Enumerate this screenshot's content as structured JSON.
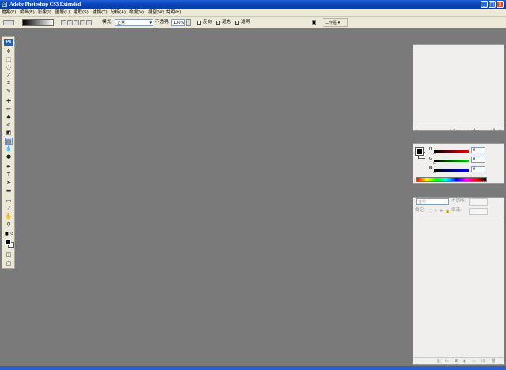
{
  "window": {
    "title": "Adobe Photoshop CS3 Extended"
  },
  "menu": [
    "檔案(F)",
    "編輯(E)",
    "影像(I)",
    "圖層(L)",
    "選取(S)",
    "濾鏡(T)",
    "分析(A)",
    "檢視(V)",
    "視窗(W)",
    "說明(H)"
  ],
  "options": {
    "mode_label": "模式:",
    "mode_value": "正常",
    "opacity_label": "不透明:",
    "opacity_value": "100%",
    "reverse_label": "反向",
    "dither_label": "遞色",
    "transparency_label": "透明",
    "workspace_label": "工作區 ▾"
  },
  "toolbox": {
    "badge": "Ps"
  },
  "color_panel": {
    "channels": [
      {
        "label": "R",
        "value": "0",
        "color": "#cc0000"
      },
      {
        "label": "G",
        "value": "0",
        "color": "#00a000"
      },
      {
        "label": "B",
        "value": "0",
        "color": "#0000cc"
      }
    ]
  },
  "layers_panel": {
    "blend_mode": "正常",
    "opacity_label": "不透明:",
    "lock_label": "鎖定:",
    "fill_label": "填滿:"
  },
  "colors": {
    "titlebar": "#0a3fb6",
    "workspace": "#7a7a7a",
    "chrome": "#ece9d8"
  }
}
